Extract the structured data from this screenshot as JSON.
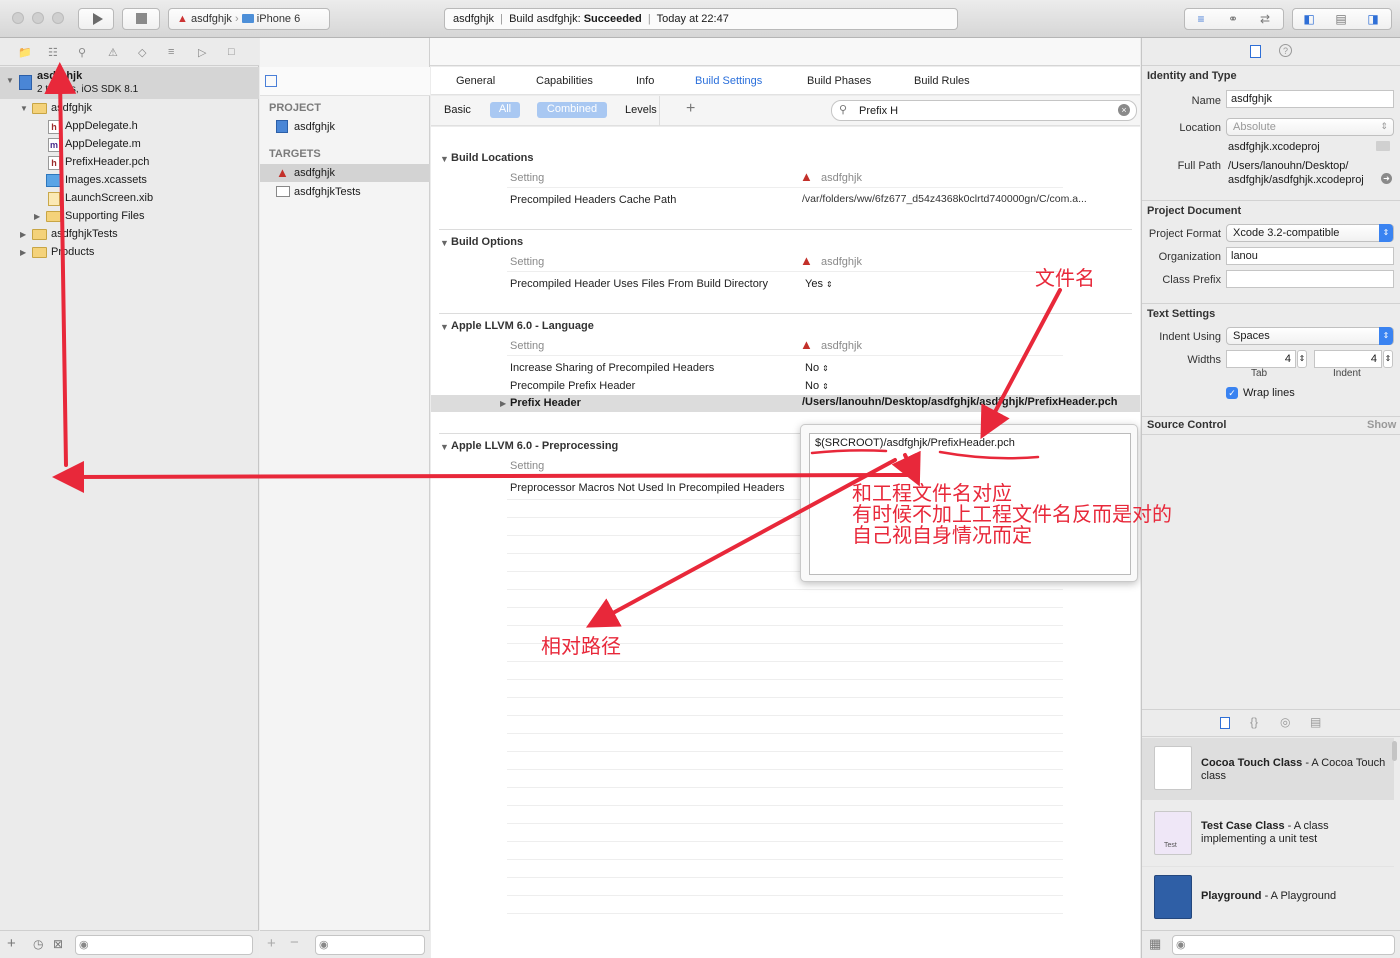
{
  "toolbar": {
    "scheme_target": "asdfghjk",
    "scheme_device": "iPhone 6",
    "status_project": "asdfghjk",
    "status_build_prefix": "Build asdfghjk:",
    "status_build_result": "Succeeded",
    "status_time": "Today at 22:47"
  },
  "navigator": {
    "project_name": "asdfghjk",
    "project_subtitle": "2 targets, iOS SDK 8.1",
    "items": [
      {
        "label": "asdfghjk",
        "kind": "folder"
      },
      {
        "label": "AppDelegate.h",
        "kind": "h"
      },
      {
        "label": "AppDelegate.m",
        "kind": "m"
      },
      {
        "label": "PrefixHeader.pch",
        "kind": "h"
      },
      {
        "label": "Images.xcassets",
        "kind": "xcassets"
      },
      {
        "label": "LaunchScreen.xib",
        "kind": "xib"
      },
      {
        "label": "Supporting Files",
        "kind": "folder"
      },
      {
        "label": "asdfghjkTests",
        "kind": "folder"
      },
      {
        "label": "Products",
        "kind": "folder"
      }
    ]
  },
  "jumpbar": {
    "crumb": "asdfghjk"
  },
  "targets_pane": {
    "project_header": "PROJECT",
    "project_item": "asdfghjk",
    "targets_header": "TARGETS",
    "targets": [
      "asdfghjk",
      "asdfghjkTests"
    ]
  },
  "editor_tabs": [
    "General",
    "Capabilities",
    "Info",
    "Build Settings",
    "Build Phases",
    "Build Rules"
  ],
  "filter": {
    "basic": "Basic",
    "all": "All",
    "combined": "Combined",
    "levels": "Levels",
    "add": "+",
    "search_value": "Prefix H"
  },
  "settings": {
    "setting_col": "Setting",
    "target_col": "asdfghjk",
    "build_locations": {
      "title": "Build Locations",
      "row_label": "Precompiled Headers Cache Path",
      "row_value": "/var/folders/ww/6fz677_d54z4368k0clrtd740000gn/C/com.a..."
    },
    "build_options": {
      "title": "Build Options",
      "row_label": "Precompiled Header Uses Files From Build Directory",
      "row_value": "Yes"
    },
    "llvm_language": {
      "title": "Apple LLVM 6.0 - Language",
      "row1_label": "Increase Sharing of Precompiled Headers",
      "row1_value": "No",
      "row2_label": "Precompile Prefix Header",
      "row2_value": "No",
      "row3_label": "Prefix Header",
      "row3_value": "/Users/lanouhn/Desktop/asdfghjk/asdfghjk/PrefixHeader.pch"
    },
    "llvm_preprocessing": {
      "title": "Apple LLVM 6.0 - Preprocessing",
      "row_label": "Preprocessor Macros Not Used In Precompiled Headers"
    }
  },
  "popover": {
    "value": "$(SRCROOT)/asdfghjk/PrefixHeader.pch"
  },
  "inspector": {
    "identity_header": "Identity and Type",
    "name_label": "Name",
    "name_value": "asdfghjk",
    "location_label": "Location",
    "location_value": "Absolute",
    "location_file": "asdfghjk.xcodeproj",
    "fullpath_label": "Full Path",
    "fullpath_line1": "/Users/lanouhn/Desktop/",
    "fullpath_line2": "asdfghjk/asdfghjk.xcodeproj",
    "project_doc_header": "Project Document",
    "format_label": "Project Format",
    "format_value": "Xcode 3.2-compatible",
    "org_label": "Organization",
    "org_value": "lanou",
    "classprefix_label": "Class Prefix",
    "classprefix_value": "",
    "text_settings_header": "Text Settings",
    "indent_label": "Indent Using",
    "indent_value": "Spaces",
    "widths_label": "Widths",
    "tab_value": "4",
    "indent_width_value": "4",
    "tab_caption": "Tab",
    "indent_caption": "Indent",
    "wrap_label": "Wrap lines",
    "source_control_header": "Source Control",
    "show_label": "Show"
  },
  "library": [
    {
      "title": "Cocoa Touch Class",
      "desc": " - A Cocoa Touch class"
    },
    {
      "title": "Test Case Class",
      "desc": " - A class implementing a unit test"
    },
    {
      "title": "Playground",
      "desc": " - A Playground"
    }
  ],
  "library_icon_badge": "Test",
  "annotations": {
    "file_name": "文件名",
    "note_line1": "和工程文件名对应",
    "note_line2": "有时候不加上工程文件名反而是对的",
    "note_line3": "自己视自身情况而定",
    "relative_path": "相对路径",
    "color": "#e8283a"
  }
}
